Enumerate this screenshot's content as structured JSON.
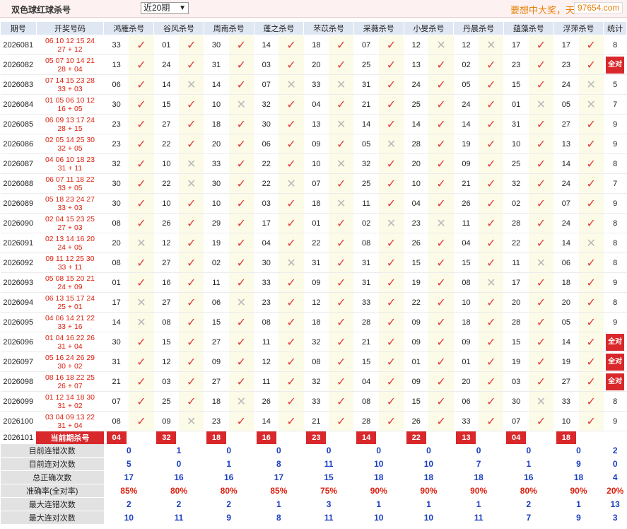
{
  "header": {
    "title": "双色球红球杀号",
    "range_select": "近20期",
    "slogan": "要想中大奖，天",
    "site": "97654.com"
  },
  "table": {
    "col_period": "期号",
    "col_draw": "开奖号码",
    "experts": [
      "鸿雁杀号",
      "谷风杀号",
      "周南杀号",
      "蓬之杀号",
      "芣苡杀号",
      "采薇杀号",
      "小旻杀号",
      "丹晨杀号",
      "蕴藻杀号",
      "浮萍杀号"
    ],
    "col_stat": "统计",
    "rows": [
      {
        "period": "2026081",
        "reds": "06 10 12 15 24",
        "blue": "27 + 12",
        "kills": [
          "33",
          "01",
          "30",
          "14",
          "18",
          "07",
          "12",
          "12",
          "17",
          "17"
        ],
        "hits": [
          1,
          1,
          1,
          1,
          1,
          1,
          0,
          0,
          1,
          1
        ],
        "stat": "8"
      },
      {
        "period": "2026082",
        "reds": "05 07 10 14 21",
        "blue": "28 + 04",
        "kills": [
          "13",
          "24",
          "31",
          "03",
          "20",
          "25",
          "13",
          "02",
          "23",
          "23"
        ],
        "hits": [
          1,
          1,
          1,
          1,
          1,
          1,
          1,
          1,
          1,
          1
        ],
        "stat": "全对"
      },
      {
        "period": "2026083",
        "reds": "07 14 15 23 28",
        "blue": "33 + 03",
        "kills": [
          "06",
          "14",
          "14",
          "07",
          "33",
          "31",
          "24",
          "05",
          "15",
          "24"
        ],
        "hits": [
          1,
          0,
          1,
          0,
          0,
          1,
          1,
          1,
          1,
          0
        ],
        "stat": "5"
      },
      {
        "period": "2026084",
        "reds": "01 05 06 10 12",
        "blue": "16 + 05",
        "kills": [
          "30",
          "15",
          "10",
          "32",
          "04",
          "21",
          "25",
          "24",
          "01",
          "05"
        ],
        "hits": [
          1,
          1,
          0,
          1,
          1,
          1,
          1,
          1,
          0,
          0
        ],
        "stat": "7"
      },
      {
        "period": "2026085",
        "reds": "06 09 13 17 24",
        "blue": "28 + 15",
        "kills": [
          "23",
          "27",
          "18",
          "30",
          "13",
          "14",
          "14",
          "14",
          "31",
          "27"
        ],
        "hits": [
          1,
          1,
          1,
          1,
          0,
          1,
          1,
          1,
          1,
          1
        ],
        "stat": "9"
      },
      {
        "period": "2026086",
        "reds": "02 05 14 25 30",
        "blue": "32 + 05",
        "kills": [
          "23",
          "22",
          "20",
          "06",
          "09",
          "05",
          "28",
          "19",
          "10",
          "13"
        ],
        "hits": [
          1,
          1,
          1,
          1,
          1,
          0,
          1,
          1,
          1,
          1
        ],
        "stat": "9"
      },
      {
        "period": "2026087",
        "reds": "04 06 10 18 23",
        "blue": "31 + 11",
        "kills": [
          "32",
          "10",
          "33",
          "22",
          "10",
          "32",
          "20",
          "09",
          "25",
          "14"
        ],
        "hits": [
          1,
          0,
          1,
          1,
          0,
          1,
          1,
          1,
          1,
          1
        ],
        "stat": "8"
      },
      {
        "period": "2026088",
        "reds": "06 07 11 18 22",
        "blue": "33 + 05",
        "kills": [
          "30",
          "22",
          "30",
          "22",
          "07",
          "25",
          "10",
          "21",
          "32",
          "24"
        ],
        "hits": [
          1,
          0,
          1,
          0,
          1,
          1,
          1,
          1,
          1,
          1
        ],
        "stat": "7"
      },
      {
        "period": "2026089",
        "reds": "05 18 23 24 27",
        "blue": "33 + 03",
        "kills": [
          "30",
          "10",
          "10",
          "03",
          "18",
          "11",
          "04",
          "26",
          "02",
          "07"
        ],
        "hits": [
          1,
          1,
          1,
          1,
          0,
          1,
          1,
          1,
          1,
          1
        ],
        "stat": "9"
      },
      {
        "period": "2026090",
        "reds": "02 04 15 23 25",
        "blue": "27 + 03",
        "kills": [
          "08",
          "26",
          "29",
          "17",
          "01",
          "02",
          "23",
          "11",
          "28",
          "24"
        ],
        "hits": [
          1,
          1,
          1,
          1,
          1,
          0,
          0,
          1,
          1,
          1
        ],
        "stat": "8"
      },
      {
        "period": "2026091",
        "reds": "02 13 14 16 20",
        "blue": "24 + 05",
        "kills": [
          "20",
          "12",
          "19",
          "04",
          "22",
          "08",
          "26",
          "04",
          "22",
          "14"
        ],
        "hits": [
          0,
          1,
          1,
          1,
          1,
          1,
          1,
          1,
          1,
          0
        ],
        "stat": "8"
      },
      {
        "period": "2026092",
        "reds": "09 11 12 25 30",
        "blue": "33 + 11",
        "kills": [
          "08",
          "27",
          "02",
          "30",
          "31",
          "31",
          "15",
          "15",
          "11",
          "06"
        ],
        "hits": [
          1,
          1,
          1,
          0,
          1,
          1,
          1,
          1,
          0,
          1
        ],
        "stat": "8"
      },
      {
        "period": "2026093",
        "reds": "05 08 15 20 21",
        "blue": "24 + 09",
        "kills": [
          "01",
          "16",
          "11",
          "33",
          "09",
          "31",
          "19",
          "08",
          "17",
          "18"
        ],
        "hits": [
          1,
          1,
          1,
          1,
          1,
          1,
          1,
          0,
          1,
          1
        ],
        "stat": "9"
      },
      {
        "period": "2026094",
        "reds": "06 13 15 17 24",
        "blue": "25 + 01",
        "kills": [
          "17",
          "27",
          "06",
          "23",
          "12",
          "33",
          "22",
          "10",
          "20",
          "20"
        ],
        "hits": [
          0,
          1,
          0,
          1,
          1,
          1,
          1,
          1,
          1,
          1
        ],
        "stat": "8"
      },
      {
        "period": "2026095",
        "reds": "04 06 14 21 22",
        "blue": "33 + 16",
        "kills": [
          "14",
          "08",
          "15",
          "08",
          "18",
          "28",
          "09",
          "18",
          "28",
          "05"
        ],
        "hits": [
          0,
          1,
          1,
          1,
          1,
          1,
          1,
          1,
          1,
          1
        ],
        "stat": "9"
      },
      {
        "period": "2026096",
        "reds": "01 04 16 22 26",
        "blue": "31 + 04",
        "kills": [
          "30",
          "15",
          "27",
          "11",
          "32",
          "21",
          "09",
          "09",
          "15",
          "14"
        ],
        "hits": [
          1,
          1,
          1,
          1,
          1,
          1,
          1,
          1,
          1,
          1
        ],
        "stat": "全对"
      },
      {
        "period": "2026097",
        "reds": "05 16 24 26 29",
        "blue": "30 + 02",
        "kills": [
          "31",
          "12",
          "09",
          "12",
          "08",
          "15",
          "01",
          "01",
          "19",
          "19"
        ],
        "hits": [
          1,
          1,
          1,
          1,
          1,
          1,
          1,
          1,
          1,
          1
        ],
        "stat": "全对"
      },
      {
        "period": "2026098",
        "reds": "08 16 18 22 25",
        "blue": "26 + 07",
        "kills": [
          "21",
          "03",
          "27",
          "11",
          "32",
          "04",
          "09",
          "20",
          "03",
          "27"
        ],
        "hits": [
          1,
          1,
          1,
          1,
          1,
          1,
          1,
          1,
          1,
          1
        ],
        "stat": "全对"
      },
      {
        "period": "2026099",
        "reds": "01 12 14 18 30",
        "blue": "31 + 02",
        "kills": [
          "07",
          "25",
          "18",
          "26",
          "33",
          "08",
          "15",
          "06",
          "30",
          "33"
        ],
        "hits": [
          1,
          1,
          0,
          1,
          1,
          1,
          1,
          1,
          0,
          1
        ],
        "stat": "8"
      },
      {
        "period": "2026100",
        "reds": "03 04 09 13 22",
        "blue": "31 + 04",
        "kills": [
          "08",
          "09",
          "23",
          "14",
          "21",
          "28",
          "26",
          "33",
          "07",
          "10"
        ],
        "hits": [
          1,
          0,
          1,
          1,
          1,
          1,
          1,
          1,
          1,
          1
        ],
        "stat": "9"
      }
    ],
    "current": {
      "period": "2026101",
      "label": "当前期杀号",
      "kills": [
        "04",
        "32",
        "18",
        "16",
        "23",
        "14",
        "22",
        "13",
        "04",
        "18"
      ]
    },
    "summary": [
      {
        "label": "目前连错次数",
        "values": [
          "0",
          "1",
          "0",
          "0",
          "0",
          "0",
          "0",
          "0",
          "0",
          "0"
        ],
        "total": "2"
      },
      {
        "label": "目前连对次数",
        "values": [
          "5",
          "0",
          "1",
          "8",
          "11",
          "10",
          "10",
          "7",
          "1",
          "9"
        ],
        "total": "0"
      },
      {
        "label": "总正确次数",
        "values": [
          "17",
          "16",
          "16",
          "17",
          "15",
          "18",
          "18",
          "18",
          "16",
          "18"
        ],
        "total": "4"
      },
      {
        "label": "准确率(全对率)",
        "values": [
          "85%",
          "80%",
          "80%",
          "85%",
          "75%",
          "90%",
          "90%",
          "90%",
          "80%",
          "90%"
        ],
        "total": "20%"
      },
      {
        "label": "最大连错次数",
        "values": [
          "2",
          "2",
          "2",
          "1",
          "3",
          "1",
          "1",
          "1",
          "2",
          "1"
        ],
        "total": "13"
      },
      {
        "label": "最大连对次数",
        "values": [
          "10",
          "11",
          "9",
          "8",
          "11",
          "10",
          "10",
          "11",
          "7",
          "9"
        ],
        "total": "3"
      }
    ]
  },
  "icons": {
    "hit": "check-icon",
    "miss": "cross-icon"
  },
  "colors": {
    "accent_red": "#d9282b",
    "header_blue": "#dfe7f3",
    "value_blue": "#1a3ec2",
    "slogan_orange": "#e8820c"
  }
}
